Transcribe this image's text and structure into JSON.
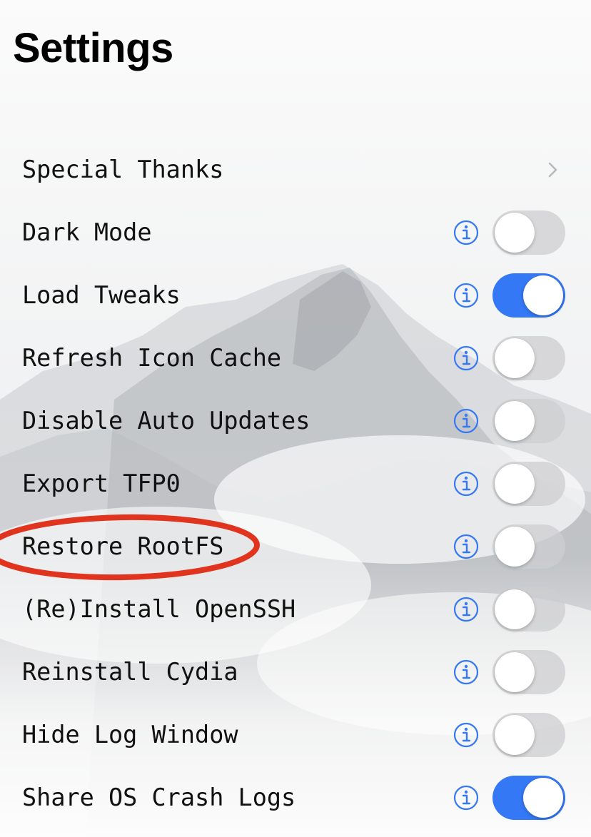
{
  "header": {
    "title": "Settings"
  },
  "settings": {
    "items": [
      {
        "label": "Special Thanks",
        "control": "chevron"
      },
      {
        "label": "Dark Mode",
        "control": "toggle",
        "on": false
      },
      {
        "label": "Load Tweaks",
        "control": "toggle",
        "on": true
      },
      {
        "label": "Refresh Icon Cache",
        "control": "toggle",
        "on": false
      },
      {
        "label": "Disable Auto Updates",
        "control": "toggle",
        "on": false
      },
      {
        "label": "Export TFP0",
        "control": "toggle",
        "on": false
      },
      {
        "label": "Restore RootFS",
        "control": "toggle",
        "on": false
      },
      {
        "label": "(Re)Install OpenSSH",
        "control": "toggle",
        "on": false
      },
      {
        "label": "Reinstall Cydia",
        "control": "toggle",
        "on": false
      },
      {
        "label": "Hide Log Window",
        "control": "toggle",
        "on": false
      },
      {
        "label": "Share OS Crash Logs",
        "control": "toggle",
        "on": true
      }
    ]
  },
  "icons": {
    "info": "info-circle-icon",
    "disclosure": "chevron-right-icon"
  },
  "colors": {
    "accent": "#3478f6",
    "toggle_off": "#cdcdd0",
    "annotation": "#e0341e",
    "text": "#111111"
  }
}
